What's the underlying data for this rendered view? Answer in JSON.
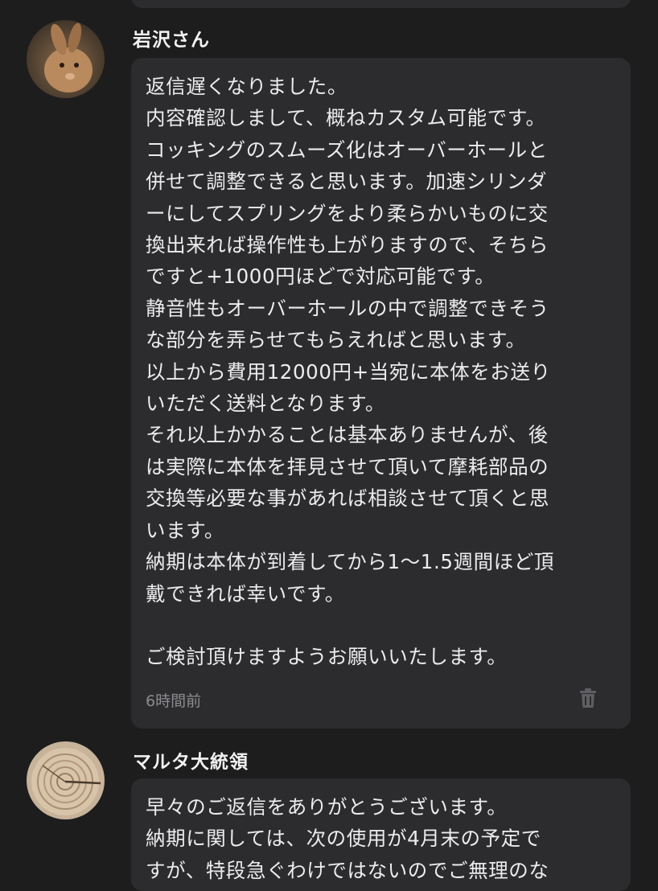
{
  "messages": [
    {
      "author": "岩沢さん",
      "avatar_icon": "rabbit-avatar",
      "body": "返信遅くなりました。\n内容確認しまして、概ねカスタム可能です。\nコッキングのスムーズ化はオーバーホールと\n併せて調整できると思います。加速シリンダ\nーにしてスプリングをより柔らかいものに交\n換出来れば操作性も上がりますので、そちら\nですと+1000円ほどで対応可能です。\n静音性もオーバーホールの中で調整できそう\nな部分を弄らせてもらえればと思います。\n以上から費用12000円+当宛に本体をお送り\nいただく送料となります。\nそれ以上かかることは基本ありませんが、後\nは実際に本体を拝見させて頂いて摩耗部品の\n交換等必要な事があれば相談させて頂くと思\nいます。\n納期は本体が到着してから1〜1.5週間ほど頂\n戴できれば幸いです。\n\nご検討頂けますようお願いいたします。",
      "timestamp": "6時間前",
      "delete_icon": "trash-icon"
    },
    {
      "author": "マルタ大統領",
      "avatar_icon": "wood-slice-avatar",
      "body": "早々のご返信をありがとうございます。\n納期に関しては、次の使用が4月末の予定で\nすが、特段急ぐわけではないのでご無理のな"
    }
  ],
  "colors": {
    "background": "#1d1d1e",
    "bubble": "#2c2c2e",
    "text": "#ececed",
    "muted": "#8c8c90"
  }
}
